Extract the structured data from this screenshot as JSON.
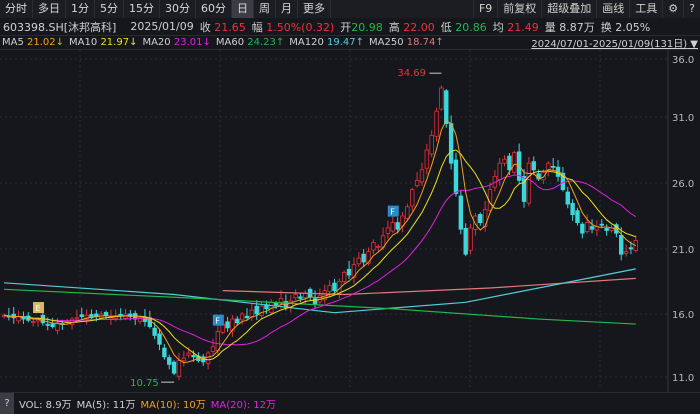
{
  "tabs": [
    "分时",
    "多日",
    "1分",
    "5分",
    "15分",
    "30分",
    "60分",
    "日",
    "周",
    "月",
    "更多"
  ],
  "active_tab": "日",
  "toolbar_right": [
    "F9",
    "前复权",
    "超级叠加",
    "画线",
    "工具"
  ],
  "toolbar_icons": [
    "gear-icon",
    "help-icon"
  ],
  "info": {
    "code": "603398.SH[沐邦高科]",
    "date": "2025/01/09",
    "close_label": "收",
    "close": "21.65",
    "amp_label": "幅",
    "amp": "1.50%(0.32)",
    "open_label": "开",
    "open": "20.98",
    "high_label": "高",
    "high": "22.00",
    "low_label": "低",
    "low": "20.86",
    "avg_label": "均",
    "avg": "21.49",
    "vol_label": "量",
    "vol": "8.87万",
    "turn_label": "换",
    "turn": "2.05%"
  },
  "ma": [
    {
      "name": "MA5",
      "value": "21.02↓",
      "color": "#f0a020"
    },
    {
      "name": "MA10",
      "value": "21.97↓",
      "color": "#e8e020"
    },
    {
      "name": "MA20",
      "value": "23.01↓",
      "color": "#e020e0"
    },
    {
      "name": "MA60",
      "value": "24.23↑",
      "color": "#1fb84a"
    },
    {
      "name": "MA120",
      "value": "19.47↑",
      "color": "#4fd0d8"
    },
    {
      "name": "MA250",
      "value": "18.74↑",
      "color": "#e07a78"
    }
  ],
  "range": "2024/07/01-2025/01/09(131日)",
  "chart_data": {
    "type": "candlestick",
    "yticks": [
      "36.0",
      "31.0",
      "26.0",
      "21.0",
      "16.0",
      "11.0"
    ],
    "closes": [
      15.9,
      15.8,
      15.7,
      15.8,
      15.6,
      15.5,
      15.4,
      15.6,
      15.3,
      15.1,
      15.0,
      15.3,
      15.2,
      15.4,
      15.6,
      15.7,
      15.8,
      15.9,
      15.7,
      15.8,
      16.0,
      15.9,
      15.7,
      15.8,
      15.9,
      16.0,
      15.8,
      15.6,
      15.7,
      15.4,
      15.0,
      14.3,
      13.6,
      12.6,
      12.0,
      11.3,
      12.3,
      12.5,
      12.9,
      12.6,
      12.3,
      12.2,
      12.9,
      13.4,
      14.6,
      15.2,
      14.9,
      15.6,
      15.3,
      16.0,
      15.7,
      16.3,
      16.0,
      16.6,
      16.4,
      16.9,
      16.7,
      17.2,
      16.5,
      17.0,
      17.5,
      17.2,
      17.6,
      17.3,
      16.8,
      17.4,
      17.8,
      18.2,
      17.8,
      18.5,
      19.2,
      19.0,
      19.8,
      20.3,
      20.0,
      20.8,
      21.5,
      21.2,
      22.0,
      22.6,
      23.0,
      22.5,
      23.5,
      24.2,
      25.5,
      26.2,
      27.0,
      28.5,
      29.6,
      31.5,
      33.5,
      30.5,
      27.5,
      25.2,
      22.5,
      20.6,
      22.6,
      23.5,
      23.0,
      24.0,
      25.5,
      26.5,
      27.5,
      27.8,
      27.0,
      28.3,
      26.2,
      24.6,
      27.5,
      27.0,
      26.3,
      26.8,
      27.5,
      27.2,
      26.5,
      25.5,
      24.4,
      23.6,
      23.0,
      22.2,
      23.0,
      22.5,
      22.7,
      22.8,
      22.4,
      22.6,
      22.2,
      20.6,
      20.8,
      21.0,
      21.65
    ],
    "ma60": [
      [
        0,
        17.9
      ],
      [
        40,
        17.2
      ],
      [
        80,
        16.4
      ],
      [
        110,
        15.6
      ],
      [
        130,
        15.2
      ]
    ],
    "ma120": [
      [
        0,
        18.4
      ],
      [
        35,
        17.5
      ],
      [
        68,
        16.1
      ],
      [
        95,
        16.9
      ],
      [
        130,
        19.47
      ]
    ],
    "ma250": [
      [
        45,
        17.8
      ],
      [
        70,
        17.5
      ],
      [
        100,
        18.0
      ],
      [
        130,
        18.74
      ]
    ],
    "high_label": "34.69",
    "low_label": "10.75",
    "markers": [
      {
        "label": "E",
        "index": 7
      },
      {
        "label": "F",
        "index": 44
      },
      {
        "label": "F",
        "index": 80
      }
    ]
  },
  "volume": {
    "vol": "VOL: 8.9万",
    "ma5": "MA(5): 11万",
    "ma10": "MA(10): 10万",
    "ma20": "MA(20): 12万",
    "help": "?"
  }
}
